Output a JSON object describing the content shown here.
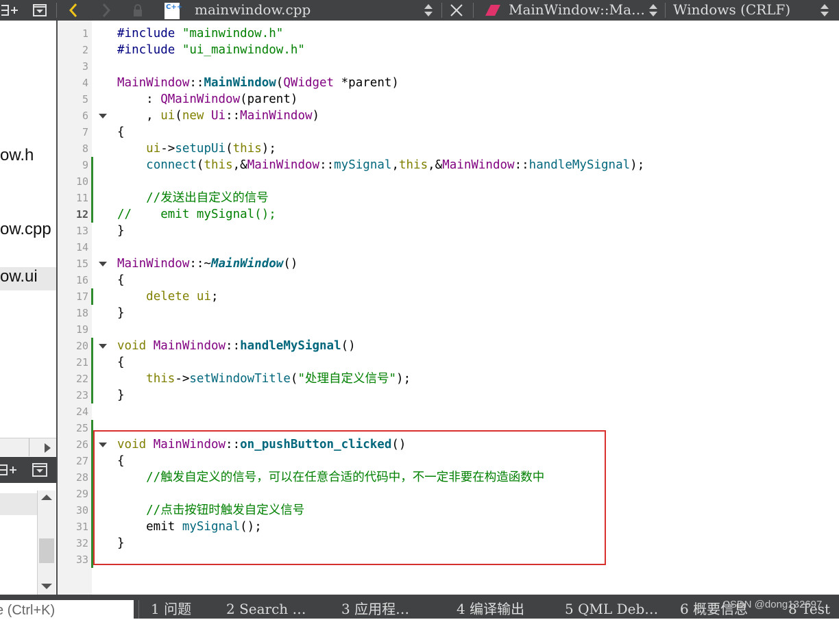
{
  "editor_toolbar": {
    "file_name": "mainwindow.cpp",
    "file_type_badge": "C++",
    "symbol": "MainWindow::Ma…",
    "line_ending": "Windows (CRLF)",
    "icons": [
      "split-icon",
      "close-pane-icon",
      "back-arrow-icon",
      "forward-arrow-icon",
      "lock-icon",
      "close-icon",
      "symbol-icon"
    ]
  },
  "project_tree": {
    "items": [
      "ow.h",
      "ow.cpp",
      "ow.ui"
    ]
  },
  "editor": {
    "current_line": 12,
    "lines": [
      {
        "n": "1",
        "tokens": [
          [
            "pp",
            "#include "
          ],
          [
            "str",
            "\"mainwindow.h\""
          ]
        ]
      },
      {
        "n": "2",
        "tokens": [
          [
            "pp",
            "#include "
          ],
          [
            "str",
            "\"ui_mainwindow.h\""
          ]
        ]
      },
      {
        "n": "3",
        "tokens": []
      },
      {
        "n": "4",
        "tokens": [
          [
            "cls",
            "MainWindow"
          ],
          [
            "",
            "::"
          ],
          [
            "fnb",
            "MainWindow"
          ],
          [
            "",
            "("
          ],
          [
            "cls",
            "QWidget"
          ],
          [
            "",
            " *parent)"
          ]
        ]
      },
      {
        "n": "5",
        "tokens": [
          [
            "",
            "    : "
          ],
          [
            "cls",
            "QMainWindow"
          ],
          [
            "",
            "(parent)"
          ]
        ]
      },
      {
        "n": "6",
        "fold": true,
        "tokens": [
          [
            "",
            "    , "
          ],
          [
            "kw",
            "ui"
          ],
          [
            "",
            "("
          ],
          [
            "kw",
            "new "
          ],
          [
            "cls",
            "Ui"
          ],
          [
            "",
            "::"
          ],
          [
            "cls",
            "MainWindow"
          ],
          [
            "",
            ")"
          ]
        ]
      },
      {
        "n": "7",
        "tokens": [
          [
            "",
            "{"
          ]
        ]
      },
      {
        "n": "8",
        "tokens": [
          [
            "",
            "    "
          ],
          [
            "kw",
            "ui"
          ],
          [
            "",
            "->"
          ],
          [
            "fn",
            "setupUi"
          ],
          [
            "",
            "("
          ],
          [
            "kw",
            "this"
          ],
          [
            "",
            ");"
          ]
        ]
      },
      {
        "n": "9",
        "tokens": [
          [
            "",
            "    "
          ],
          [
            "fn",
            "connect"
          ],
          [
            "",
            "("
          ],
          [
            "kw",
            "this"
          ],
          [
            "",
            ",&"
          ],
          [
            "cls",
            "MainWindow"
          ],
          [
            "",
            "::"
          ],
          [
            "fn",
            "mySignal"
          ],
          [
            "",
            ","
          ],
          [
            "kw",
            "this"
          ],
          [
            "",
            ",&"
          ],
          [
            "cls",
            "MainWindow"
          ],
          [
            "",
            "::"
          ],
          [
            "fn",
            "handleMySignal"
          ],
          [
            "",
            ");"
          ]
        ]
      },
      {
        "n": "10",
        "tokens": []
      },
      {
        "n": "11",
        "tokens": [
          [
            "cm",
            "    //发送出自定义的信号"
          ]
        ]
      },
      {
        "n": "12",
        "tokens": [
          [
            "cm",
            "//    emit mySignal();"
          ]
        ]
      },
      {
        "n": "13",
        "tokens": [
          [
            "",
            "}"
          ]
        ]
      },
      {
        "n": "14",
        "tokens": []
      },
      {
        "n": "15",
        "fold": true,
        "tokens": [
          [
            "cls",
            "MainWindow"
          ],
          [
            "",
            "::~"
          ],
          [
            "fni",
            "MainWindow"
          ],
          [
            "",
            "()"
          ]
        ]
      },
      {
        "n": "16",
        "tokens": [
          [
            "",
            "{"
          ]
        ]
      },
      {
        "n": "17",
        "tokens": [
          [
            "",
            "    "
          ],
          [
            "kw",
            "delete "
          ],
          [
            "kw",
            "ui"
          ],
          [
            "",
            ";"
          ]
        ]
      },
      {
        "n": "18",
        "tokens": [
          [
            "",
            "}"
          ]
        ]
      },
      {
        "n": "19",
        "tokens": []
      },
      {
        "n": "20",
        "fold": true,
        "tokens": [
          [
            "kw",
            "void "
          ],
          [
            "cls",
            "MainWindow"
          ],
          [
            "",
            "::"
          ],
          [
            "fnb",
            "handleMySignal"
          ],
          [
            "",
            "()"
          ]
        ]
      },
      {
        "n": "21",
        "tokens": [
          [
            "",
            "{"
          ]
        ]
      },
      {
        "n": "22",
        "tokens": [
          [
            "",
            "    "
          ],
          [
            "kw",
            "this"
          ],
          [
            "",
            "->"
          ],
          [
            "fn",
            "setWindowTitle"
          ],
          [
            "",
            "("
          ],
          [
            "str",
            "\"处理自定义信号\""
          ],
          [
            "",
            ");"
          ]
        ]
      },
      {
        "n": "23",
        "tokens": [
          [
            "",
            "}"
          ]
        ]
      },
      {
        "n": "24",
        "tokens": []
      },
      {
        "n": "25",
        "tokens": []
      },
      {
        "n": "26",
        "fold": true,
        "tokens": [
          [
            "kw",
            "void "
          ],
          [
            "cls",
            "MainWindow"
          ],
          [
            "",
            "::"
          ],
          [
            "fnb",
            "on_pushButton_clicked"
          ],
          [
            "",
            "()"
          ]
        ]
      },
      {
        "n": "27",
        "tokens": [
          [
            "",
            "{"
          ]
        ]
      },
      {
        "n": "28",
        "tokens": [
          [
            "cm",
            "    //触发自定义的信号，可以在任意合适的代码中，不一定非要在构造函数中"
          ]
        ]
      },
      {
        "n": "29",
        "tokens": []
      },
      {
        "n": "30",
        "tokens": [
          [
            "cm",
            "    //点击按钮时触发自定义信号"
          ]
        ]
      },
      {
        "n": "31",
        "tokens": [
          [
            "",
            "    emit "
          ],
          [
            "fn",
            "mySignal"
          ],
          [
            "",
            "();"
          ]
        ]
      },
      {
        "n": "32",
        "tokens": [
          [
            "",
            "}"
          ]
        ]
      },
      {
        "n": "33",
        "tokens": []
      }
    ]
  },
  "locator": {
    "placeholder": "e (Ctrl+K)"
  },
  "output_tabs": [
    {
      "label": "1  问题"
    },
    {
      "label": "2  Search …"
    },
    {
      "label": "3  应用程…"
    },
    {
      "label": "4  编译输出"
    },
    {
      "label": "5  QML Deb…"
    },
    {
      "label": "6  概要信息"
    },
    {
      "label": "8  Test"
    }
  ],
  "watermark": "CSDN @dong132697",
  "colors": {
    "toolbar_bg": "#404244",
    "highlight_box": "#d9302e",
    "change_marker": "#2e8b2e"
  }
}
